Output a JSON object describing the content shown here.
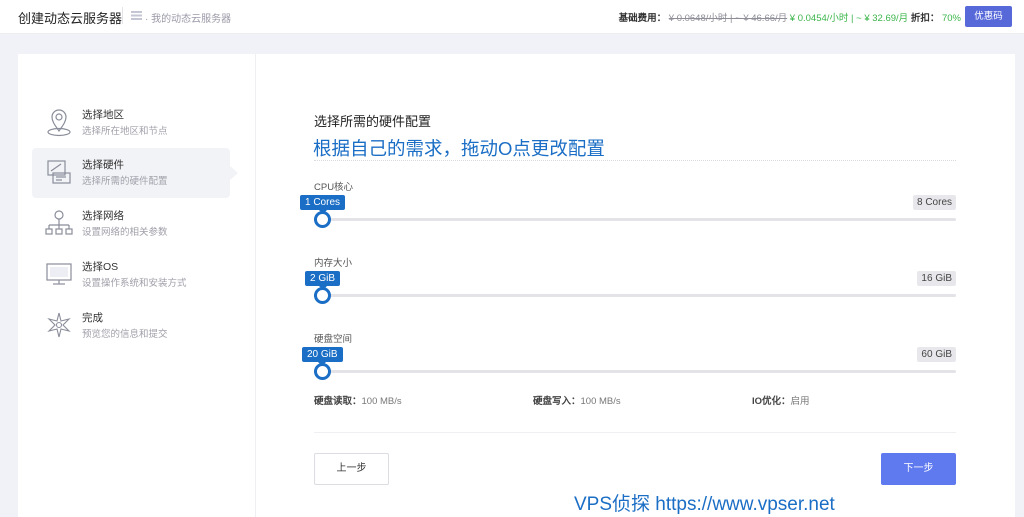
{
  "header": {
    "title": "创建动态云服务器",
    "breadcrumb": "· 我的动态云服务器",
    "pricing": {
      "base_label": "基础费用：",
      "old_price": "¥ 0.0648/小时 | ~ ¥ 46.66/月",
      "new_price": "¥ 0.0454/小时 | ~ ¥ 32.69/月",
      "discount_label": "折扣：",
      "discount_value": "70%"
    },
    "coupon_button": "优惠码"
  },
  "steps": [
    {
      "title": "选择地区",
      "desc": "选择所在地区和节点",
      "icon": "region-pin-icon",
      "active": false
    },
    {
      "title": "选择硬件",
      "desc": "选择所需的硬件配置",
      "icon": "hardware-icon",
      "active": true
    },
    {
      "title": "选择网络",
      "desc": "设置网络的相关参数",
      "icon": "network-icon",
      "active": false
    },
    {
      "title": "选择OS",
      "desc": "设置操作系统和安装方式",
      "icon": "monitor-icon",
      "active": false
    },
    {
      "title": "完成",
      "desc": "预览您的信息和提交",
      "icon": "complete-icon",
      "active": false
    }
  ],
  "main": {
    "section_title": "选择所需的硬件配置",
    "tip": "根据自己的需求，拖动O点更改配置",
    "sliders": [
      {
        "label": "CPU核心",
        "value_label": "1 Cores",
        "max_label": "8 Cores",
        "fraction": 0
      },
      {
        "label": "内存大小",
        "value_label": "2 GiB",
        "max_label": "16 GiB",
        "fraction": 0
      },
      {
        "label": "硬盘空间",
        "value_label": "20 GiB",
        "max_label": "60 GiB",
        "fraction": 0
      }
    ],
    "disk": {
      "read_label": "硬盘读取：",
      "read_value": "100 MB/s",
      "write_label": "硬盘写入：",
      "write_value": "100 MB/s",
      "io_label": "IO优化：",
      "io_value": "启用"
    },
    "prev_button": "上一步",
    "next_button": "下一步"
  },
  "watermark": "VPS侦探 https://www.vpser.net",
  "colors": {
    "accent": "#1b6ec5",
    "primary_button": "#5f79ef",
    "coupon": "#5769d9",
    "price_new": "#3bb54a"
  }
}
